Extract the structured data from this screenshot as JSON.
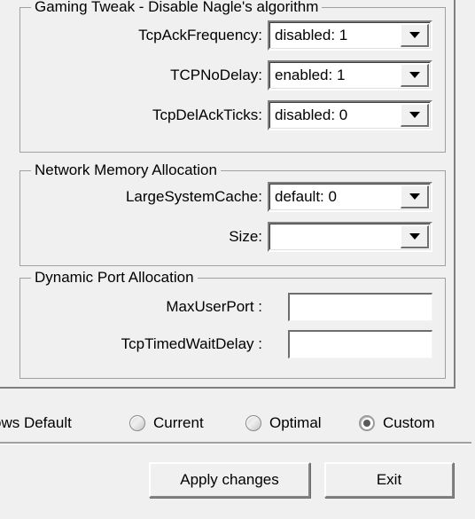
{
  "groups": [
    {
      "id": "gaming",
      "title": "Gaming Tweak - Disable Nagle's algorithm",
      "rows": [
        {
          "label": "TcpAckFrequency:",
          "control": "combobox",
          "value": "disabled: 1"
        },
        {
          "label": "TCPNoDelay:",
          "control": "combobox",
          "value": "enabled: 1"
        },
        {
          "label": "TcpDelAckTicks:",
          "control": "combobox",
          "value": "disabled: 0"
        }
      ]
    },
    {
      "id": "memory",
      "title": "Network Memory Allocation",
      "rows": [
        {
          "label": "LargeSystemCache:",
          "control": "combobox",
          "value": "default: 0"
        },
        {
          "label": "Size:",
          "control": "combobox",
          "value": ""
        }
      ]
    },
    {
      "id": "ports",
      "title": "Dynamic Port Allocation",
      "rows": [
        {
          "label": "MaxUserPort :",
          "control": "textbox",
          "value": "",
          "placeholder": ""
        },
        {
          "label": "TcpTimedWaitDelay :",
          "control": "textbox",
          "value": "",
          "placeholder": ""
        }
      ]
    }
  ],
  "presets": {
    "options": [
      {
        "label": "ows Default",
        "selected": false
      },
      {
        "label": "Current",
        "selected": false
      },
      {
        "label": "Optimal",
        "selected": false
      },
      {
        "label": "Custom",
        "selected": true
      }
    ]
  },
  "buttons": {
    "apply": "Apply changes",
    "exit": "Exit"
  },
  "icons": {
    "dropdown": "chevron-down-icon"
  },
  "colors": {
    "face": "#f0f0f0",
    "field": "#ffffff",
    "border": "#a0a0a0",
    "shadow": "#808080",
    "text": "#000000"
  }
}
